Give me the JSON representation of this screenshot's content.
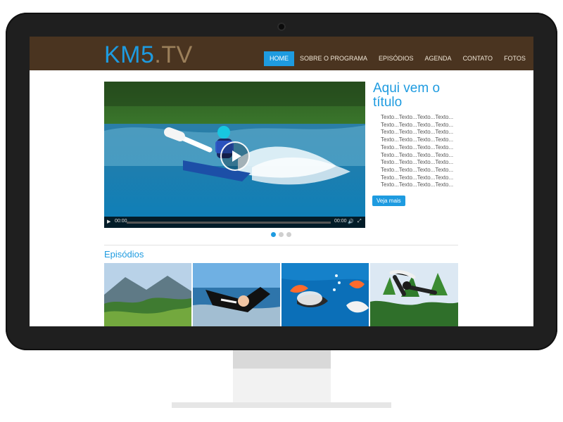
{
  "site": {
    "logo_main": "KM5",
    "logo_dot_tv": ".TV"
  },
  "nav": {
    "items": [
      {
        "label": "HOME",
        "active": true
      },
      {
        "label": "SOBRE O PROGRAMA",
        "active": false
      },
      {
        "label": "EPISÓDIOS",
        "active": false
      },
      {
        "label": "AGENDA",
        "active": false
      },
      {
        "label": "CONTATO",
        "active": false
      },
      {
        "label": "FOTOS",
        "active": false
      }
    ]
  },
  "hero": {
    "time_left": "00:00",
    "time_right": "00:00"
  },
  "sidebar": {
    "title_line1": "Aqui vem o",
    "title_line2": "título",
    "text_lines": [
      "Texto...Texto...Texto...Texto...",
      "Texto...Texto...Texto...Texto...",
      "Texto...Texto...Texto...Texto...",
      "Texto...Texto...Texto...Texto...",
      "Texto...Texto...Texto...Texto...",
      "Texto...Texto...Texto...Texto...",
      "Texto...Texto...Texto...Texto...",
      "Texto...Texto...Texto...Texto...",
      "Texto...Texto...Texto...Texto...",
      "Texto...Texto...Texto...Texto..."
    ],
    "button_label": "Veja mais"
  },
  "episodes": {
    "title": "Episódios"
  },
  "colors": {
    "accent": "#1e9be0",
    "header_bg": "#4a3420"
  },
  "icons": {
    "play": "play-icon",
    "volume": "volume-icon",
    "fullscreen": "fullscreen-icon"
  }
}
